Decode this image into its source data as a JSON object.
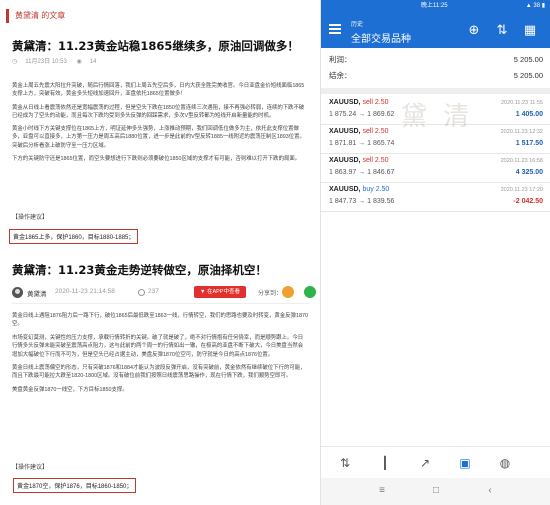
{
  "article1": {
    "breadcrumb": "黄黛清 的文章",
    "title": "黄黛清：11.23黄金站稳1865继续多，原油回调做多！",
    "date": "11月23日 10:53",
    "views": "14",
    "paragraphs": [
      "黄金上周五先震大阳拉升突破，随后行情回落，我们上周五先空后多，日内大获全胜完美收官。今日亚盘金价短线面临1865支撑上方，突破有效，黄金多头短线加速回升，亚盘依托1865位置做多！",
      "黄金从日线上看震荡依然还是宽幅震荡的过程，但是空头下跌在1850位置连续三次遇阻，接不再强必转弱，连续的下跌不破已经成为了空头的动能，而且每次下跌均受到多头反弹的回踩需求，多次V型反转都为短线开启新量能的时机。",
      "黄金小时线下方关键支撑位在1865上方，明证延伸多头强势，上涨推动预期，我们回调低位做多为主，依托此支撑位置做多，亚盘可以直接多，上方第一压力是周五高后1880位置，进一步是此前的V型反转1885一线附近的震荡压制区1893位置。突破后分析看涨上破防守至一压力区域。",
      "下方的关键防守还是1865位置，而空头要想进行下跌则必须要破位1850区域的支撑才有可能，否则难以打开下跌的局面。"
    ],
    "tip_label": "【操作建议】",
    "advice": "黄金1865上多，保护1860，目标1880-1885；"
  },
  "article2": {
    "title": "黄黛清：11.23黄金走势逆转做空，原油择机空！",
    "author": "黄黛清",
    "date": "2020-11-23 21:14:58",
    "views": "237",
    "app_button": "▼ 在APP中查看",
    "share_label": "分享到：",
    "paragraphs": [
      "黄金日线上遇阻1876阻力后一路下行，破位1865后最低跌至1863一线，行情转空，我们的思路也要及时转变，黄金反弹1870空。",
      "市场变幻莫测，关键性的压力支撑，承载行情转折的关键。破了就是破了，绝不对行情抱有任何侥幸，而是顺势跟上。今日行情多头反弹未能突破至震荡高点阻力，这与此前的两个周一的行情如出一辙，在极高的亚盘不断下破大，今日美盘当然会增加大幅破位下行而不可为，但是空头已经占据主动，美盘反弹1870位空可，防守就是今日的高点1876位置。",
      "黄金日线上震荡偏空的形态，只有突破1876和1884才能认为波段反弹开启，没有突破前，黄金依然有继续破位下行的可能，而且下跌最可能拉大跌至1820-1800区域。没有破位前我们按照日线震荡思路操作，现在行情下跌，我们顺势空即可。",
      "美盘黄金反弹1870一线空，下方目标1850支撑。"
    ],
    "tip_label": "【操作建议】",
    "advice": "黄金1870空，保护1876，目标1860-1850；"
  },
  "phone": {
    "status_time": "晚上11:25",
    "status_right": "▲ 38 ▮",
    "title_small": "历史",
    "title": "全部交易品种",
    "summary": [
      {
        "label": "利润：",
        "value": "5 205.00"
      },
      {
        "label": "结余：",
        "value": "5 205.00"
      }
    ],
    "orders": [
      {
        "symbol": "XAUUSD,",
        "type": "sell 2.50",
        "kind": "sell",
        "prices": "1 875.24 → 1 869.62",
        "date": "2020.11.23 11:55",
        "pl": "1 405.00",
        "sign": "pos"
      },
      {
        "symbol": "XAUUSD,",
        "type": "sell 2.50",
        "kind": "sell",
        "prices": "1 871.81 → 1 865.74",
        "date": "2020.11.23 12:32",
        "pl": "1 517.50",
        "sign": "pos"
      },
      {
        "symbol": "XAUUSD,",
        "type": "sell 2.50",
        "kind": "sell",
        "prices": "1 863.97 → 1 846.67",
        "date": "2020.11.23 16:58",
        "pl": "4 325.00",
        "sign": "pos"
      },
      {
        "symbol": "XAUUSD,",
        "type": "buy 2.50",
        "kind": "buy",
        "prices": "1 847.73 → 1 839.56",
        "date": "2020.11.23 17:20",
        "pl": "-2 042.50",
        "sign": "neg"
      }
    ],
    "watermark": "黛 清",
    "icons": {
      "menu": "menu-icon",
      "add": "add-order-icon",
      "sort": "sort-icon",
      "calendar": "calendar-icon"
    },
    "accent": "#1e6fd4"
  }
}
